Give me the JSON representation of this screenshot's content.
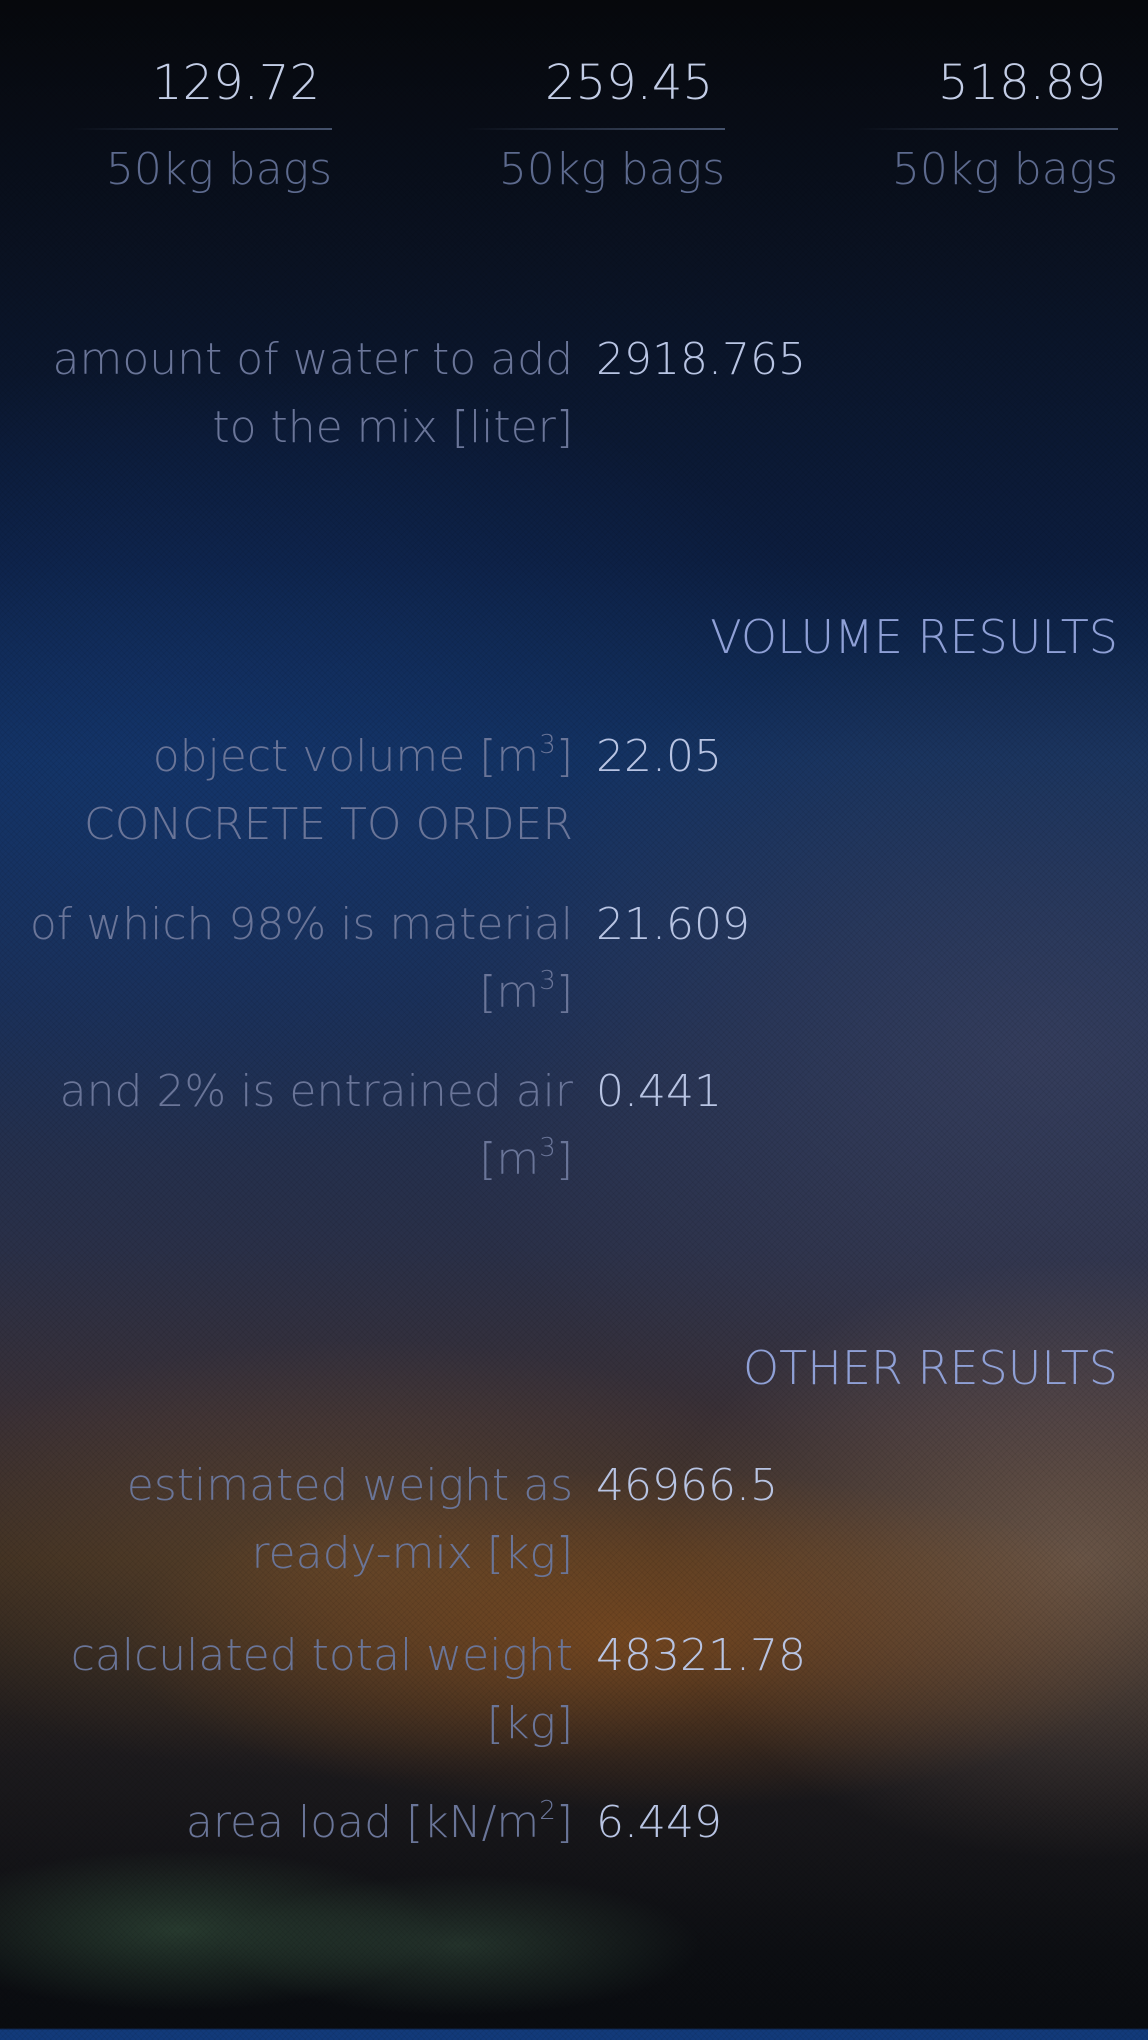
{
  "bags": [
    {
      "value": "129.72",
      "unit": "50kg bags"
    },
    {
      "value": "259.45",
      "unit": "50kg bags"
    },
    {
      "value": "518.89",
      "unit": "50kg bags"
    }
  ],
  "water": {
    "label": "amount of water to add to the mix [liter]",
    "value": "2918.765"
  },
  "volume_results": {
    "header": "VOLUME RESULTS",
    "object_volume": {
      "label_prefix": "object volume [m",
      "label_sup": "3",
      "label_suffix": "]",
      "label_line2": "CONCRETE TO ORDER",
      "value": "22.05"
    },
    "material": {
      "label_line1": "of which 98% is material",
      "label_prefix": "[m",
      "label_sup": "3",
      "label_suffix": "]",
      "value": "21.609"
    },
    "air": {
      "label_line1": "and 2% is entrained air",
      "label_prefix": "[m",
      "label_sup": "3",
      "label_suffix": "]",
      "value": "0.441"
    }
  },
  "other_results": {
    "header": "OTHER RESULTS",
    "estimated_weight": {
      "label": "estimated weight as ready-mix [kg]",
      "value": "46966.5"
    },
    "total_weight": {
      "label": "calculated total weight [kg]",
      "value": "48321.78"
    },
    "area_load": {
      "label_prefix": "area load [kN/m",
      "label_sup": "2",
      "label_suffix": "]",
      "value": "6.449"
    }
  }
}
